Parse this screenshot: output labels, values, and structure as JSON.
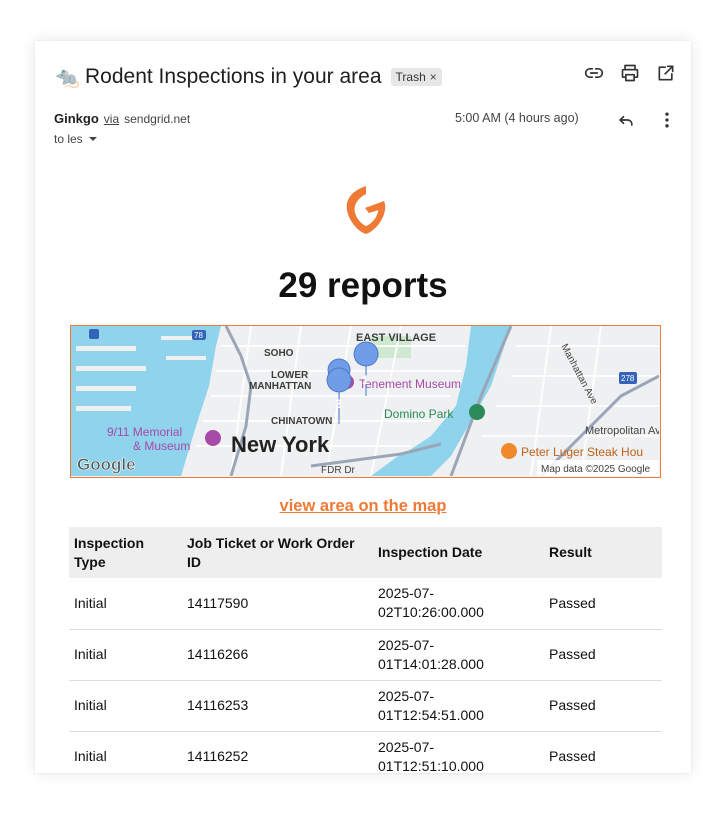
{
  "email": {
    "subject_icon": "🐀",
    "subject": "Rodent Inspections in your area",
    "label": "Trash",
    "sender_name": "Ginkgo",
    "sender_via": "via",
    "sender_domain": "sendgrid.net",
    "recipient": "to les",
    "time": "5:00 AM (4 hours ago)",
    "icons": [
      "link-icon",
      "print-icon",
      "open-in-new-icon",
      "reply-icon",
      "more-vert-icon",
      "chevron-down-icon"
    ]
  },
  "body": {
    "headline": "29 reports",
    "map_link": "view area on the map",
    "accent_color": "#ef7a35",
    "map": {
      "labels": [
        "EAST VILLAGE",
        "SOHO",
        "LOWER",
        "MANHATTAN",
        "CHINATOWN",
        "New York",
        "9/11 Memorial",
        "& Museum",
        "Tenement Museum",
        "Domino Park",
        "Metropolitan Av",
        "Peter Luger Steak Hou",
        "Manhattan Ave",
        "FDR Dr",
        "Google",
        "Map data ©2025 Google"
      ],
      "markers": [
        "1",
        "3"
      ],
      "route_shields": [
        "78",
        "278"
      ]
    },
    "table": {
      "headers": [
        "Inspection Type",
        "Job Ticket or Work Order ID",
        "Inspection Date",
        "Result"
      ],
      "rows": [
        [
          "Initial",
          "14117590",
          "2025-07-02T10:26:00.000",
          "Passed"
        ],
        [
          "Initial",
          "14116266",
          "2025-07-01T14:01:28.000",
          "Passed"
        ],
        [
          "Initial",
          "14116253",
          "2025-07-01T12:54:51.000",
          "Passed"
        ],
        [
          "Initial",
          "14116252",
          "2025-07-01T12:51:10.000",
          "Passed"
        ]
      ]
    }
  }
}
